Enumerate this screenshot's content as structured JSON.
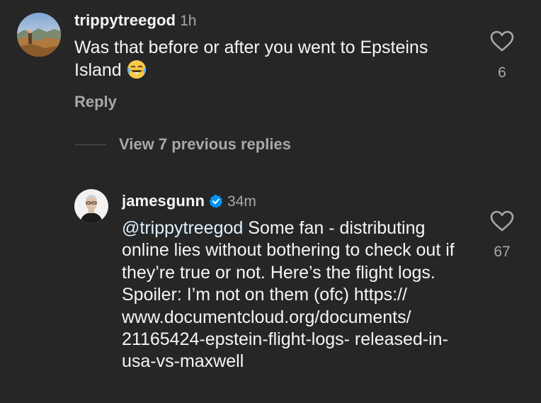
{
  "comments": [
    {
      "username": "trippytreegod",
      "time": "1h",
      "text": "Was that before or after you went to Epsteins Island",
      "emoji": "face-with-tears-of-joy-icon",
      "reply_label": "Reply",
      "like_count": "6"
    },
    {
      "username": "jamesgunn",
      "verified": true,
      "time": "34m",
      "mention": "@trippytreegod",
      "text": "Some fan - distributing online lies without bothering to check out if they’re true or not. Here’s the flight logs. Spoiler: I’m not on them (ofc) https:// www.documentcloud.org/documents/ 21165424-epstein-flight-logs- released-in-usa-vs-maxwell",
      "like_count": "67"
    }
  ],
  "view_replies_label": "View 7 previous replies",
  "colors": {
    "background": "#262626",
    "text": "#f5f5f5",
    "secondary": "#a8a8a8",
    "verified": "#0095f6",
    "mention": "#e0f1ff"
  },
  "icons": {
    "like": "heart-outline-icon",
    "verified": "verified-badge-icon"
  }
}
